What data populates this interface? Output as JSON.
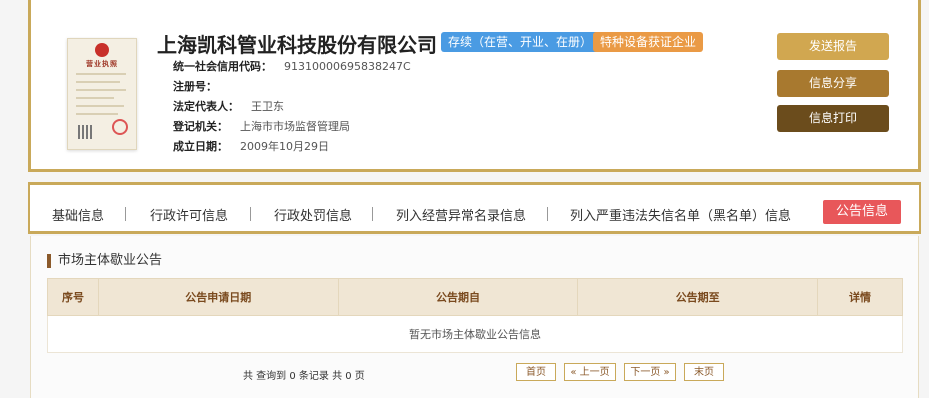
{
  "company": {
    "name": "上海凯科管业科技股份有限公司",
    "status_badge": "存续（在营、开业、在册）",
    "special_badge": "特种设备获证企业",
    "license_title": "营业执照"
  },
  "info": [
    {
      "label": "统一社会信用代码：",
      "value": "91310000695838247C"
    },
    {
      "label": "注册号：",
      "value": ""
    },
    {
      "label": "法定代表人：",
      "value": "王卫东"
    },
    {
      "label": "登记机关：",
      "value": "上海市市场监督管理局"
    },
    {
      "label": "成立日期：",
      "value": "2009年10月29日"
    }
  ],
  "actions": {
    "report": "发送报告",
    "share": "信息分享",
    "print": "信息打印"
  },
  "tabs": [
    {
      "label": "基础信息"
    },
    {
      "label": "行政许可信息"
    },
    {
      "label": "行政处罚信息"
    },
    {
      "label": "列入经营异常名录信息"
    },
    {
      "label": "列入严重违法失信名单（黑名单）信息"
    },
    {
      "label": "公告信息"
    }
  ],
  "section": {
    "title": "市场主体歇业公告",
    "columns": [
      "序号",
      "公告申请日期",
      "公告期自",
      "公告期至",
      "详情"
    ],
    "empty_text": "暂无市场主体歇业公告信息"
  },
  "pager": {
    "summary": "共 查询到 0 条记录 共 0 页",
    "first": "首页",
    "prev": "« 上一页",
    "next": "下一页 »",
    "last": "末页"
  },
  "colors": {
    "gold_border": "#c9a95a",
    "status_blue": "#4a9be3",
    "special_orange": "#ea9a45",
    "active_tab_red": "#e8575a"
  }
}
